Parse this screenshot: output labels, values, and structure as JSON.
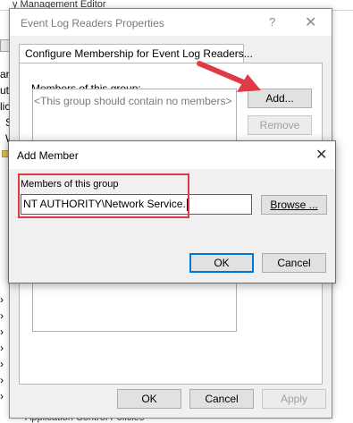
{
  "background_window": {
    "title_fragment": "y Management Editor",
    "tree_fragments": [
      "ar",
      "ut",
      "lic",
      "S",
      "W"
    ],
    "bottom_item_fragment": "Application Control Policies"
  },
  "properties_dialog": {
    "title": "Event Log Readers Properties",
    "help_glyph": "?",
    "close_glyph": "✕",
    "tab_label": "Configure Membership for Event Log Readers...",
    "members_label": "Members of this group:",
    "members_empty_text": "<This group should contain no members>",
    "add_button": "Add...",
    "remove_button": "Remove",
    "ok_button": "OK",
    "cancel_button": "Cancel",
    "apply_button": "Apply"
  },
  "add_member_dialog": {
    "title": "Add Member",
    "close_glyph": "✕",
    "field_label": "Members of this group",
    "field_value": "NT AUTHORITY\\Network Service.",
    "browse_button": "Browse ...",
    "ok_button": "OK",
    "cancel_button": "Cancel"
  },
  "annotations": {
    "arrow_color": "#e03a47",
    "highlight_color": "#e03a47"
  }
}
